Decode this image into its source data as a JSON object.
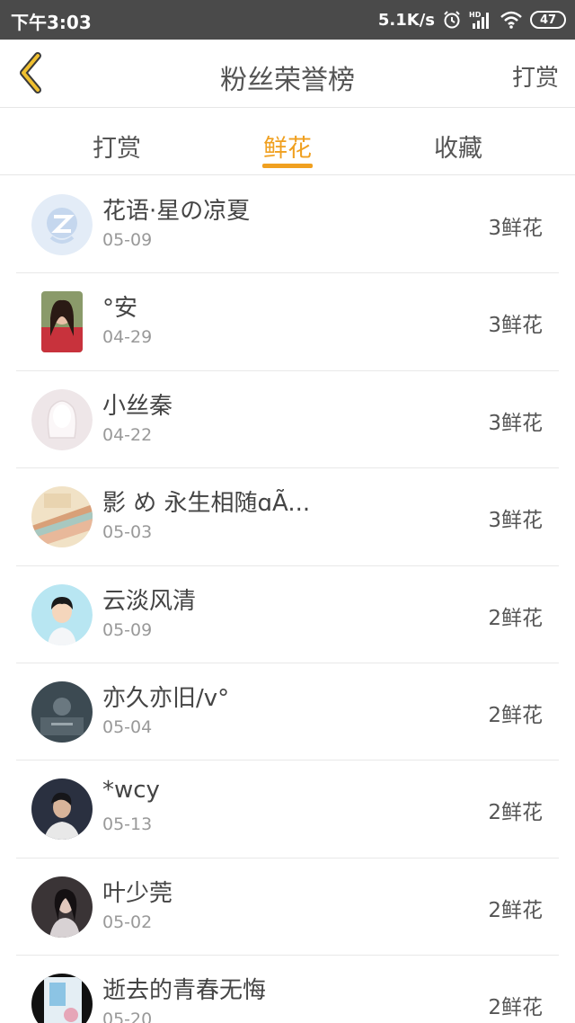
{
  "status_bar": {
    "time": "下午3:03",
    "network_speed": "5.1K/s",
    "battery": "47",
    "icons": [
      "alarm-icon",
      "signal-icon",
      "wifi-icon",
      "battery-icon"
    ]
  },
  "nav": {
    "title": "粉丝荣誉榜",
    "action_label": "打赏",
    "back_icon": "chevron-left-icon",
    "accent_color": "#f0a020"
  },
  "tabs": [
    {
      "label": "打赏",
      "active": false
    },
    {
      "label": "鲜花",
      "active": true
    },
    {
      "label": "收藏",
      "active": false
    }
  ],
  "fans": [
    {
      "name": "花语·星の凉夏",
      "date": "05-09",
      "count": "3鲜花",
      "avatar": "qq-logo-avatar"
    },
    {
      "name": "°安",
      "date": "04-29",
      "count": "3鲜花",
      "avatar": "girl-photo-avatar"
    },
    {
      "name": "小丝秦",
      "date": "04-22",
      "count": "3鲜花",
      "avatar": "default-silhouette-avatar"
    },
    {
      "name": "影 め 永生相随ɑÃ...",
      "date": "05-03",
      "count": "3鲜花",
      "avatar": "books-avatar"
    },
    {
      "name": "云淡风清",
      "date": "05-09",
      "count": "2鲜花",
      "avatar": "cartoon-boy-avatar"
    },
    {
      "name": "亦久亦旧/v°",
      "date": "05-04",
      "count": "2鲜花",
      "avatar": "dark-photo-avatar"
    },
    {
      "name": "*wcy",
      "date": "05-13",
      "count": "2鲜花",
      "avatar": "boy-photo-avatar"
    },
    {
      "name": "叶少莞",
      "date": "05-02",
      "count": "2鲜花",
      "avatar": "woman-photo-avatar"
    },
    {
      "name": "逝去的青春无悔",
      "date": "05-20",
      "count": "2鲜花",
      "avatar": "poster-avatar"
    }
  ]
}
